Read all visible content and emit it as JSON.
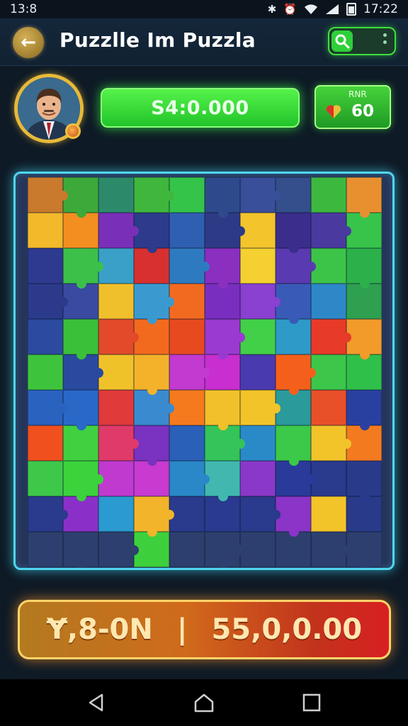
{
  "status_bar": {
    "time": "13:8",
    "clock": "17:22"
  },
  "header": {
    "title": "Puzzlle Im Puzzla"
  },
  "stats": {
    "coins": "S4:0.000",
    "lives_label": "RNR",
    "lives_value": "60"
  },
  "board": {
    "columns": 10,
    "rows": 11,
    "cells": [
      "#c97a2c",
      "#3da93a",
      "#2c8a6b",
      "#3fb63c",
      "#34c44a",
      "#2f4a8c",
      "#3a4f9a",
      "#344f8c",
      "#3db83f",
      "#e89030",
      "#f2b92a",
      "#f38e20",
      "#7a2fb8",
      "#2c3b8c",
      "#2f5fb0",
      "#2d3a86",
      "#f3c42c",
      "#3a2d8c",
      "#4a3aa0",
      "#38c44a",
      "#2d3a90",
      "#3cc04a",
      "#3aa0c8",
      "#d83030",
      "#2e7ac0",
      "#8a2fc0",
      "#f4d030",
      "#5a3ab0",
      "#3cc448",
      "#2bb04a",
      "#2c3a8c",
      "#3a4aa0",
      "#f0c02c",
      "#3a9ad0",
      "#f26a20",
      "#7a2ec0",
      "#8a40d0",
      "#3a5ab8",
      "#2e88c8",
      "#2ea050",
      "#2c4aa0",
      "#3bc03a",
      "#e24a2a",
      "#f26a1e",
      "#e84a20",
      "#9a3ad0",
      "#42d048",
      "#2e9ac8",
      "#e83a28",
      "#f29a2a",
      "#3ec43c",
      "#2a4aa0",
      "#f0c22a",
      "#f3b22a",
      "#c23ad0",
      "#c82ed0",
      "#4a3ab0",
      "#f4601c",
      "#3cc64a",
      "#2fc04a",
      "#2a62c0",
      "#2a68c8",
      "#e03a3a",
      "#3a8ad0",
      "#f57a1e",
      "#f2c02a",
      "#f2c42a",
      "#2a9a9a",
      "#e8502a",
      "#2a40a0",
      "#f0501e",
      "#40d040",
      "#e03a6a",
      "#7a32c0",
      "#2a60b8",
      "#34c45a",
      "#2a8ac8",
      "#3cc848",
      "#f2c42a",
      "#f47a20",
      "#3ec84a",
      "#3cd23c",
      "#c03ad0",
      "#c83ad0",
      "#2a88c8",
      "#40b8b0",
      "#8a38c8",
      "#2a3a9a",
      "#2a3a8c",
      "#2a3a8a",
      "#2a3a8c",
      "#8a30c8",
      "#2a9ad0",
      "#f2b42a",
      "#2a3a8c",
      "#2a3a90",
      "#2a3a8c",
      "#8a34c8",
      "#f2c42a",
      "#2a3a8a",
      "#2d3f6e",
      "#2d3f6e",
      "#2d3f6e",
      "#3ed03c",
      "#2d3f6e",
      "#2d3f6e",
      "#2d3f6e",
      "#2d3f6e",
      "#2d3f6e",
      "#2d3f6e"
    ]
  },
  "footer": {
    "score_left": "Ɏ,8-0N",
    "separator": "|",
    "score_right": "55,0,0.00"
  },
  "colors": {
    "coin_green": "#2fdc34",
    "board_glow": "#4fd6f0",
    "banner_gold": "#ffd36b"
  }
}
